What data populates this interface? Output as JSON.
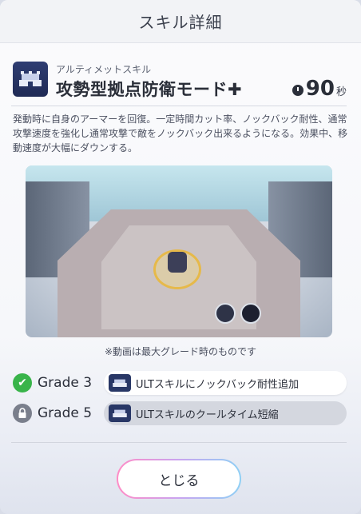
{
  "header": {
    "title": "スキル詳細"
  },
  "skill": {
    "icon": "fortress-icon",
    "type": "アルティメットスキル",
    "name": "攻勢型拠点防衛モード✚",
    "cooldown_value": "90",
    "cooldown_unit": "秒",
    "description": "発動時に自身のアーマーを回復。一定時間カット率、ノックバック耐性、通常攻撃速度を強化し通常攻撃で敵をノックバック出来るようになる。効果中、移動速度が大幅にダウンする。"
  },
  "video": {
    "caption": "※動画は最大グレード時のものです"
  },
  "grades": [
    {
      "label": "Grade 3",
      "status": "unlocked",
      "status_glyph": "✔",
      "text": "ULTスキルにノックバック耐性追加"
    },
    {
      "label": "Grade 5",
      "status": "locked",
      "status_glyph": "🔒",
      "text": "ULTスキルのクールタイム短縮"
    }
  ],
  "footer": {
    "close_label": "とじる"
  },
  "colors": {
    "accent_green": "#39b44a",
    "icon_navy": "#283766"
  }
}
